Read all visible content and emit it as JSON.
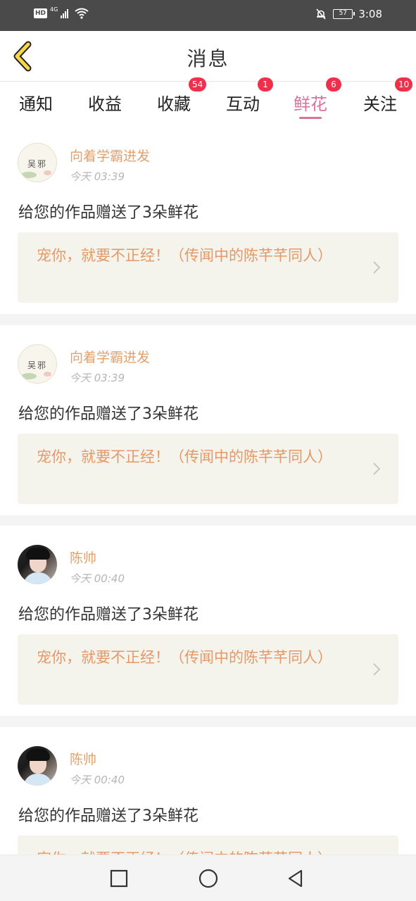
{
  "status": {
    "hd": "HD",
    "network": "4G",
    "battery": "57",
    "time": "3:08"
  },
  "header": {
    "title": "消息"
  },
  "tabs": [
    {
      "label": "通知",
      "badge": ""
    },
    {
      "label": "收益",
      "badge": ""
    },
    {
      "label": "收藏",
      "badge": "54"
    },
    {
      "label": "互动",
      "badge": "1"
    },
    {
      "label": "鲜花",
      "badge": "6",
      "active": true
    },
    {
      "label": "关注",
      "badge": "10"
    }
  ],
  "messages": [
    {
      "avatar": "吴邪",
      "user": "向着学霸进发",
      "time": "今天 03:39",
      "action": "给您的作品赠送了3朵鲜花",
      "work": "宠你，就要不正经！（传闻中的陈芊芊同人）"
    },
    {
      "avatar": "吴邪",
      "user": "向着学霸进发",
      "time": "今天 03:39",
      "action": "给您的作品赠送了3朵鲜花",
      "work": "宠你，就要不正经！（传闻中的陈芊芊同人）"
    },
    {
      "avatar": "",
      "user": "陈帅",
      "time": "今天 00:40",
      "action": "给您的作品赠送了3朵鲜花",
      "work": "宠你，就要不正经！（传闻中的陈芊芊同人）"
    },
    {
      "avatar": "",
      "user": "陈帅",
      "time": "今天 00:40",
      "action": "给您的作品赠送了3朵鲜花",
      "work": "宠你，就要不正经！（传闻中的陈芊芊同人）"
    }
  ],
  "colors": {
    "accent": "#d9739a",
    "badge": "#f0304b",
    "username": "#e3a06a",
    "work_title": "#e59868"
  },
  "icons": {
    "back": "chevron-left-icon",
    "arrow": "chevron-right-icon",
    "nav": [
      "square-icon",
      "circle-icon",
      "triangle-left-icon"
    ]
  }
}
